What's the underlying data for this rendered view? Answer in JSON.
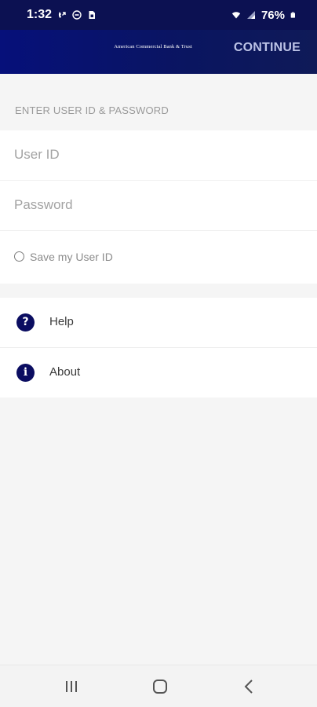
{
  "status_bar": {
    "time": "1:32",
    "battery_percent": "76%",
    "left_icons": [
      "call-forward-icon",
      "do-not-disturb-icon",
      "sim-icon"
    ],
    "right_icons": [
      "wifi-icon",
      "signal-icon",
      "battery-icon"
    ]
  },
  "header": {
    "logo_text": "American Commercial Bank & Trust",
    "continue_label": "CONTINUE",
    "background_color": "#0c1152"
  },
  "login": {
    "section_title": "ENTER USER ID & PASSWORD",
    "user_id_placeholder": "User ID",
    "user_id_value": "",
    "password_placeholder": "Password",
    "password_value": "",
    "save_user_id_label": "Save my User ID",
    "save_user_id_checked": false
  },
  "menu": {
    "items": [
      {
        "label": "Help",
        "icon": "help-icon"
      },
      {
        "label": "About",
        "icon": "info-icon"
      }
    ],
    "icon_color": "#0b0d61"
  },
  "navigation": {
    "buttons": [
      "recents-icon",
      "home-icon",
      "back-icon"
    ]
  }
}
